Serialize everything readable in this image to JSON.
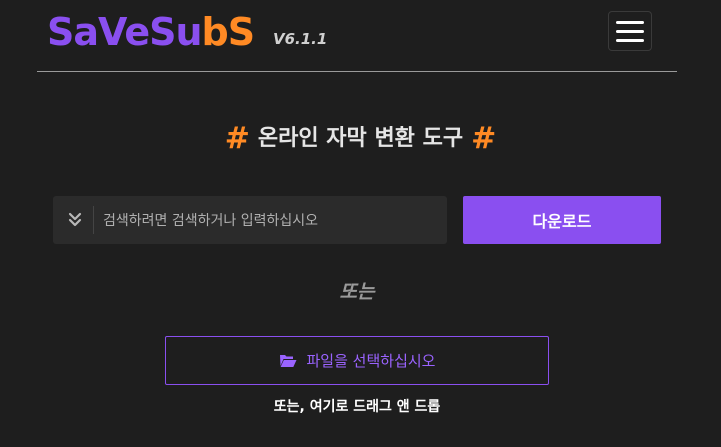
{
  "header": {
    "logo_text_a": "SaVeSu",
    "logo_text_b": "bS",
    "version": "V6.1.1"
  },
  "title": {
    "hash_left": "#",
    "text": "온라인 자막 변환 도구",
    "hash_right": "#"
  },
  "search": {
    "placeholder": "검색하려면 검색하거나 입력하십시오",
    "value": ""
  },
  "download_button": "다운로드",
  "or_label": "또는",
  "file_button": "파일을 선택하십시오",
  "drop_label": "또는, 여기로 드래그 앤 드롭",
  "colors": {
    "accent": "#8a4ff0",
    "brand_orange": "#ff8a24",
    "background": "#1e1e1e"
  }
}
